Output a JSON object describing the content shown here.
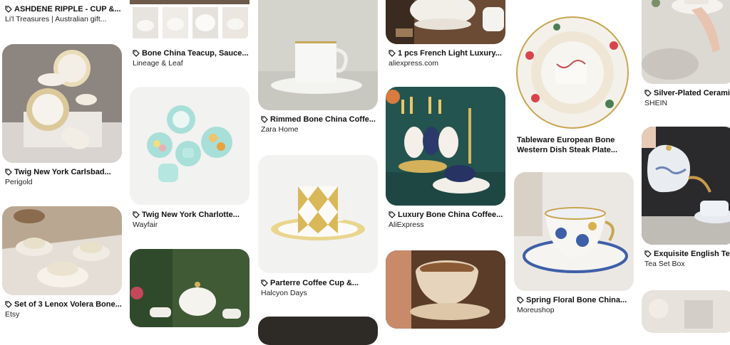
{
  "pins": {
    "c1p1": {
      "title": "ASHDENE RIPPLE - CUP &...",
      "source": "Li'l Treasures | Australian gift..."
    },
    "c1p2": {
      "title": "Twig New York Carlsbad...",
      "source": "Perigold"
    },
    "c1p3": {
      "title": "Set of 3 Lenox Volera Bone...",
      "source": "Etsy"
    },
    "c2p1": {
      "title": "Bone China Teacup, Sauce...",
      "source": "Lineage & Leaf"
    },
    "c2p2": {
      "title": "Twig New York Charlotte...",
      "source": "Wayfair"
    },
    "c3p1": {
      "title": "Rimmed Bone China Coffe...",
      "source": "Zara Home"
    },
    "c3p2": {
      "title": "Parterre Coffee Cup &...",
      "source": "Halcyon Days"
    },
    "c4p1": {
      "title": "1 pcs French Light Luxury...",
      "source": "aliexpress.com"
    },
    "c4p2": {
      "title": "Luxury Bone China Coffee...",
      "source": "AliExpress"
    },
    "c5p1": {
      "title": "Tableware European Bone Western Dish Steak Plate...",
      "title_line1": "Tableware European Bone",
      "title_line2": "Western Dish Steak Plate...",
      "source": ""
    },
    "c5p2": {
      "title": "Spring Floral Bone China...",
      "source": "Moreushop"
    },
    "c6p1": {
      "title": "Silver-Plated Ceramic",
      "source": "SHEIN"
    },
    "c6p2": {
      "title": "Exquisite English Tea",
      "source": "Tea Set Box"
    }
  }
}
